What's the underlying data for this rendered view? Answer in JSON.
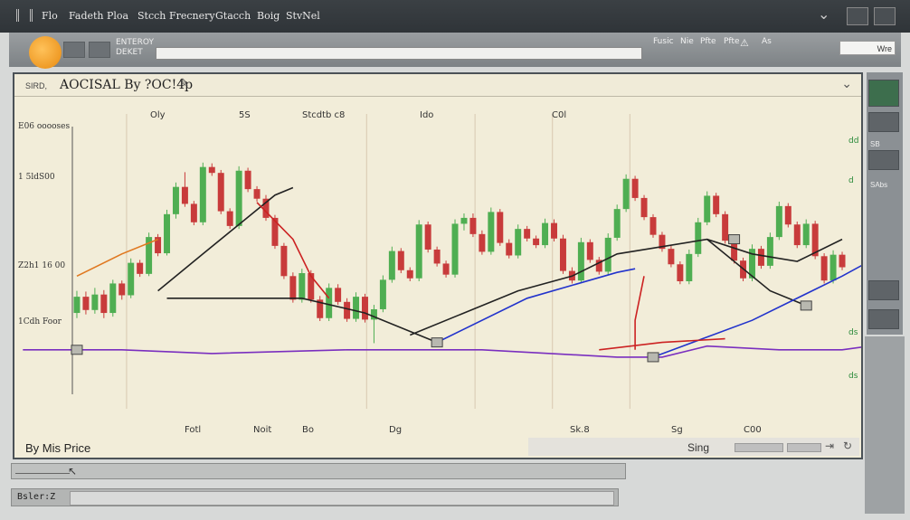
{
  "menubar": {
    "items": [
      "Flo",
      "Fadeth",
      "Ploa",
      "Stcch",
      "Frecnery",
      "Gtacch",
      "Boig",
      "StvNel"
    ]
  },
  "toolbar": {
    "label_line1": "ENTEROY",
    "label_line2": "DEKET",
    "links": [
      "Fusic",
      "Nie",
      "Pfte"
    ],
    "right_label": "As",
    "search_value": "Wre"
  },
  "chart_window": {
    "prefix": "SIRD,",
    "title": "AOCISAL By ?OC!4p",
    "footer_label": "By Mis Price",
    "footer_right": "Sing"
  },
  "side_panel": {
    "labels": [
      "SB",
      "SAbs"
    ]
  },
  "bottom": {
    "tag2": "Bsler:Z"
  },
  "chart_data": {
    "type": "candlestick",
    "top_labels": [
      "Oly",
      "5S",
      "Stcdtb c8",
      "Ido",
      "C0l"
    ],
    "y_tick_labels": [
      "E06 ooooses",
      "1 5ldS00",
      "Z2h1 16 00",
      "1Cdh Foor"
    ],
    "x_tick_labels": [
      "Fotl",
      "Noit",
      "Bo",
      "Dg",
      "Sk.8",
      "Sg",
      "C00"
    ],
    "right_tick_labels": [
      "dd",
      "d",
      "ds",
      "ds"
    ],
    "ohlc": [
      [
        28.0,
        31.0,
        27.3,
        30.2
      ],
      [
        30.2,
        30.9,
        27.8,
        28.4
      ],
      [
        28.4,
        31.4,
        27.9,
        30.5
      ],
      [
        30.5,
        31.1,
        27.3,
        28.0
      ],
      [
        28.0,
        32.5,
        27.5,
        32.0
      ],
      [
        32.0,
        32.4,
        29.8,
        30.4
      ],
      [
        30.4,
        35.4,
        30.0,
        34.8
      ],
      [
        34.8,
        35.2,
        32.9,
        33.3
      ],
      [
        33.3,
        38.9,
        33.0,
        38.3
      ],
      [
        38.3,
        38.7,
        35.7,
        36.1
      ],
      [
        36.1,
        42.0,
        35.8,
        41.4
      ],
      [
        41.4,
        45.7,
        40.8,
        45.1
      ],
      [
        45.1,
        47.1,
        42.4,
        42.8
      ],
      [
        42.8,
        43.2,
        39.9,
        40.3
      ],
      [
        40.3,
        48.4,
        39.9,
        47.8
      ],
      [
        47.8,
        48.3,
        46.6,
        47.0
      ],
      [
        47.0,
        47.4,
        41.4,
        41.8
      ],
      [
        41.8,
        42.2,
        39.4,
        39.8
      ],
      [
        39.8,
        47.9,
        39.4,
        47.3
      ],
      [
        47.3,
        47.7,
        44.4,
        44.8
      ],
      [
        44.8,
        45.2,
        43.1,
        43.5
      ],
      [
        43.5,
        44.0,
        40.5,
        40.9
      ],
      [
        40.9,
        41.3,
        36.7,
        37.1
      ],
      [
        37.1,
        37.5,
        32.6,
        33.0
      ],
      [
        33.0,
        33.5,
        29.4,
        29.8
      ],
      [
        29.8,
        34.0,
        29.4,
        33.4
      ],
      [
        33.4,
        33.8,
        29.4,
        29.8
      ],
      [
        29.8,
        30.3,
        26.9,
        27.3
      ],
      [
        27.3,
        32.0,
        26.9,
        31.4
      ],
      [
        31.4,
        31.9,
        29.1,
        29.5
      ],
      [
        29.5,
        30.0,
        26.8,
        27.2
      ],
      [
        27.2,
        30.8,
        26.8,
        30.2
      ],
      [
        30.2,
        30.6,
        26.7,
        27.1
      ],
      [
        27.1,
        29.1,
        23.9,
        28.5
      ],
      [
        28.5,
        33.1,
        28.1,
        32.5
      ],
      [
        32.5,
        37.0,
        32.1,
        36.4
      ],
      [
        36.4,
        36.8,
        33.4,
        33.8
      ],
      [
        33.8,
        34.2,
        32.3,
        32.7
      ],
      [
        32.7,
        40.6,
        32.3,
        40.0
      ],
      [
        40.0,
        40.4,
        36.2,
        36.6
      ],
      [
        36.6,
        37.0,
        34.3,
        34.7
      ],
      [
        34.7,
        35.1,
        32.8,
        33.2
      ],
      [
        33.2,
        40.7,
        32.8,
        40.1
      ],
      [
        40.1,
        41.5,
        39.2,
        40.9
      ],
      [
        40.9,
        41.5,
        38.3,
        38.7
      ],
      [
        38.7,
        39.2,
        35.9,
        36.3
      ],
      [
        36.3,
        42.3,
        35.9,
        41.7
      ],
      [
        41.7,
        42.1,
        37.1,
        37.5
      ],
      [
        37.5,
        38.0,
        35.4,
        35.8
      ],
      [
        35.8,
        40.0,
        35.4,
        39.4
      ],
      [
        39.4,
        39.8,
        37.7,
        38.1
      ],
      [
        38.1,
        38.5,
        36.8,
        37.2
      ],
      [
        37.2,
        40.8,
        36.8,
        40.2
      ],
      [
        40.2,
        40.7,
        37.7,
        38.1
      ],
      [
        38.1,
        38.6,
        33.3,
        33.7
      ],
      [
        33.7,
        34.2,
        32.0,
        32.4
      ],
      [
        32.4,
        38.2,
        32.0,
        37.6
      ],
      [
        37.6,
        38.0,
        34.8,
        35.2
      ],
      [
        35.2,
        35.6,
        33.2,
        33.6
      ],
      [
        33.6,
        38.8,
        33.2,
        38.2
      ],
      [
        38.2,
        42.7,
        37.8,
        42.1
      ],
      [
        42.1,
        46.8,
        41.7,
        46.2
      ],
      [
        46.2,
        46.6,
        43.2,
        43.6
      ],
      [
        43.6,
        44.0,
        40.6,
        41.0
      ],
      [
        41.0,
        41.4,
        38.2,
        38.6
      ],
      [
        38.6,
        39.0,
        36.3,
        36.7
      ],
      [
        36.7,
        37.1,
        34.2,
        34.6
      ],
      [
        34.6,
        35.0,
        31.9,
        32.3
      ],
      [
        32.3,
        36.6,
        31.9,
        36.0
      ],
      [
        36.0,
        40.9,
        35.6,
        40.3
      ],
      [
        40.3,
        44.5,
        39.9,
        43.9
      ],
      [
        43.9,
        44.3,
        41.0,
        41.4
      ],
      [
        41.4,
        41.8,
        37.4,
        37.8
      ],
      [
        37.8,
        38.2,
        34.7,
        35.1
      ],
      [
        35.1,
        35.5,
        32.3,
        32.7
      ],
      [
        32.7,
        37.3,
        32.3,
        36.7
      ],
      [
        36.7,
        37.1,
        34.0,
        34.4
      ],
      [
        34.4,
        38.9,
        34.0,
        38.3
      ],
      [
        38.3,
        43.1,
        37.9,
        42.5
      ],
      [
        42.5,
        42.9,
        39.6,
        40.0
      ],
      [
        40.0,
        40.4,
        36.8,
        37.2
      ],
      [
        37.2,
        40.7,
        36.8,
        40.1
      ],
      [
        40.1,
        40.5,
        35.3,
        35.7
      ],
      [
        35.7,
        36.1,
        32.0,
        32.4
      ],
      [
        32.4,
        36.5,
        32.0,
        35.9
      ],
      [
        35.9,
        36.3,
        33.8,
        34.2
      ]
    ],
    "overlays": [
      {
        "name": "",
        "color": "#222222",
        "points": [
          [
            9,
            31
          ],
          [
            14,
            36
          ],
          [
            19,
            41
          ],
          [
            22,
            44
          ],
          [
            24,
            45
          ]
        ]
      },
      {
        "name": "",
        "color": "#222222",
        "points": [
          [
            10,
            30
          ],
          [
            25,
            30
          ],
          [
            32,
            28
          ],
          [
            40,
            24
          ]
        ]
      },
      {
        "name": "",
        "color": "#222222",
        "points": [
          [
            37,
            25
          ],
          [
            49,
            31
          ],
          [
            55,
            33
          ],
          [
            60,
            36
          ],
          [
            70,
            38
          ],
          [
            75,
            36
          ],
          [
            80,
            35
          ],
          [
            85,
            38
          ]
        ]
      },
      {
        "name": "",
        "color": "#222222",
        "points": [
          [
            70,
            38
          ],
          [
            77,
            31
          ],
          [
            81,
            29
          ]
        ]
      },
      {
        "name": "",
        "color": "#2233cc",
        "points": [
          [
            40,
            24
          ],
          [
            50,
            30
          ],
          [
            60,
            33.5
          ],
          [
            62,
            34
          ]
        ]
      },
      {
        "name": "",
        "color": "#2233cc",
        "points": [
          [
            64,
            22
          ],
          [
            75,
            27
          ],
          [
            85,
            33
          ],
          [
            88,
            35
          ]
        ]
      },
      {
        "name": "",
        "color": "#cc2222",
        "points": [
          [
            20,
            43
          ],
          [
            24,
            38
          ],
          [
            26,
            33
          ],
          [
            28,
            30
          ]
        ]
      },
      {
        "name": "",
        "color": "#cc2222",
        "points": [
          [
            62,
            23
          ],
          [
            62,
            27
          ],
          [
            63,
            33
          ]
        ]
      },
      {
        "name": "",
        "color": "#e07820",
        "points": [
          [
            0,
            33
          ],
          [
            5,
            36
          ],
          [
            9,
            38
          ]
        ]
      },
      {
        "name": "",
        "color": "#7a2fbf",
        "points": [
          [
            -6,
            23
          ],
          [
            5,
            23
          ],
          [
            15,
            22.5
          ],
          [
            30,
            23
          ],
          [
            45,
            23
          ],
          [
            60,
            22
          ],
          [
            65,
            22
          ],
          [
            70,
            23.5
          ],
          [
            78,
            23
          ],
          [
            85,
            23
          ],
          [
            88,
            23.5
          ]
        ]
      },
      {
        "name": "",
        "color": "#cc2222",
        "points": [
          [
            58,
            23
          ],
          [
            65,
            24
          ],
          [
            72,
            24.5
          ]
        ]
      }
    ],
    "markers": [
      [
        0,
        23
      ],
      [
        40,
        24
      ],
      [
        64,
        22
      ],
      [
        81,
        29
      ],
      [
        73,
        38
      ]
    ],
    "ylim": [
      15,
      55
    ],
    "grid": true
  }
}
